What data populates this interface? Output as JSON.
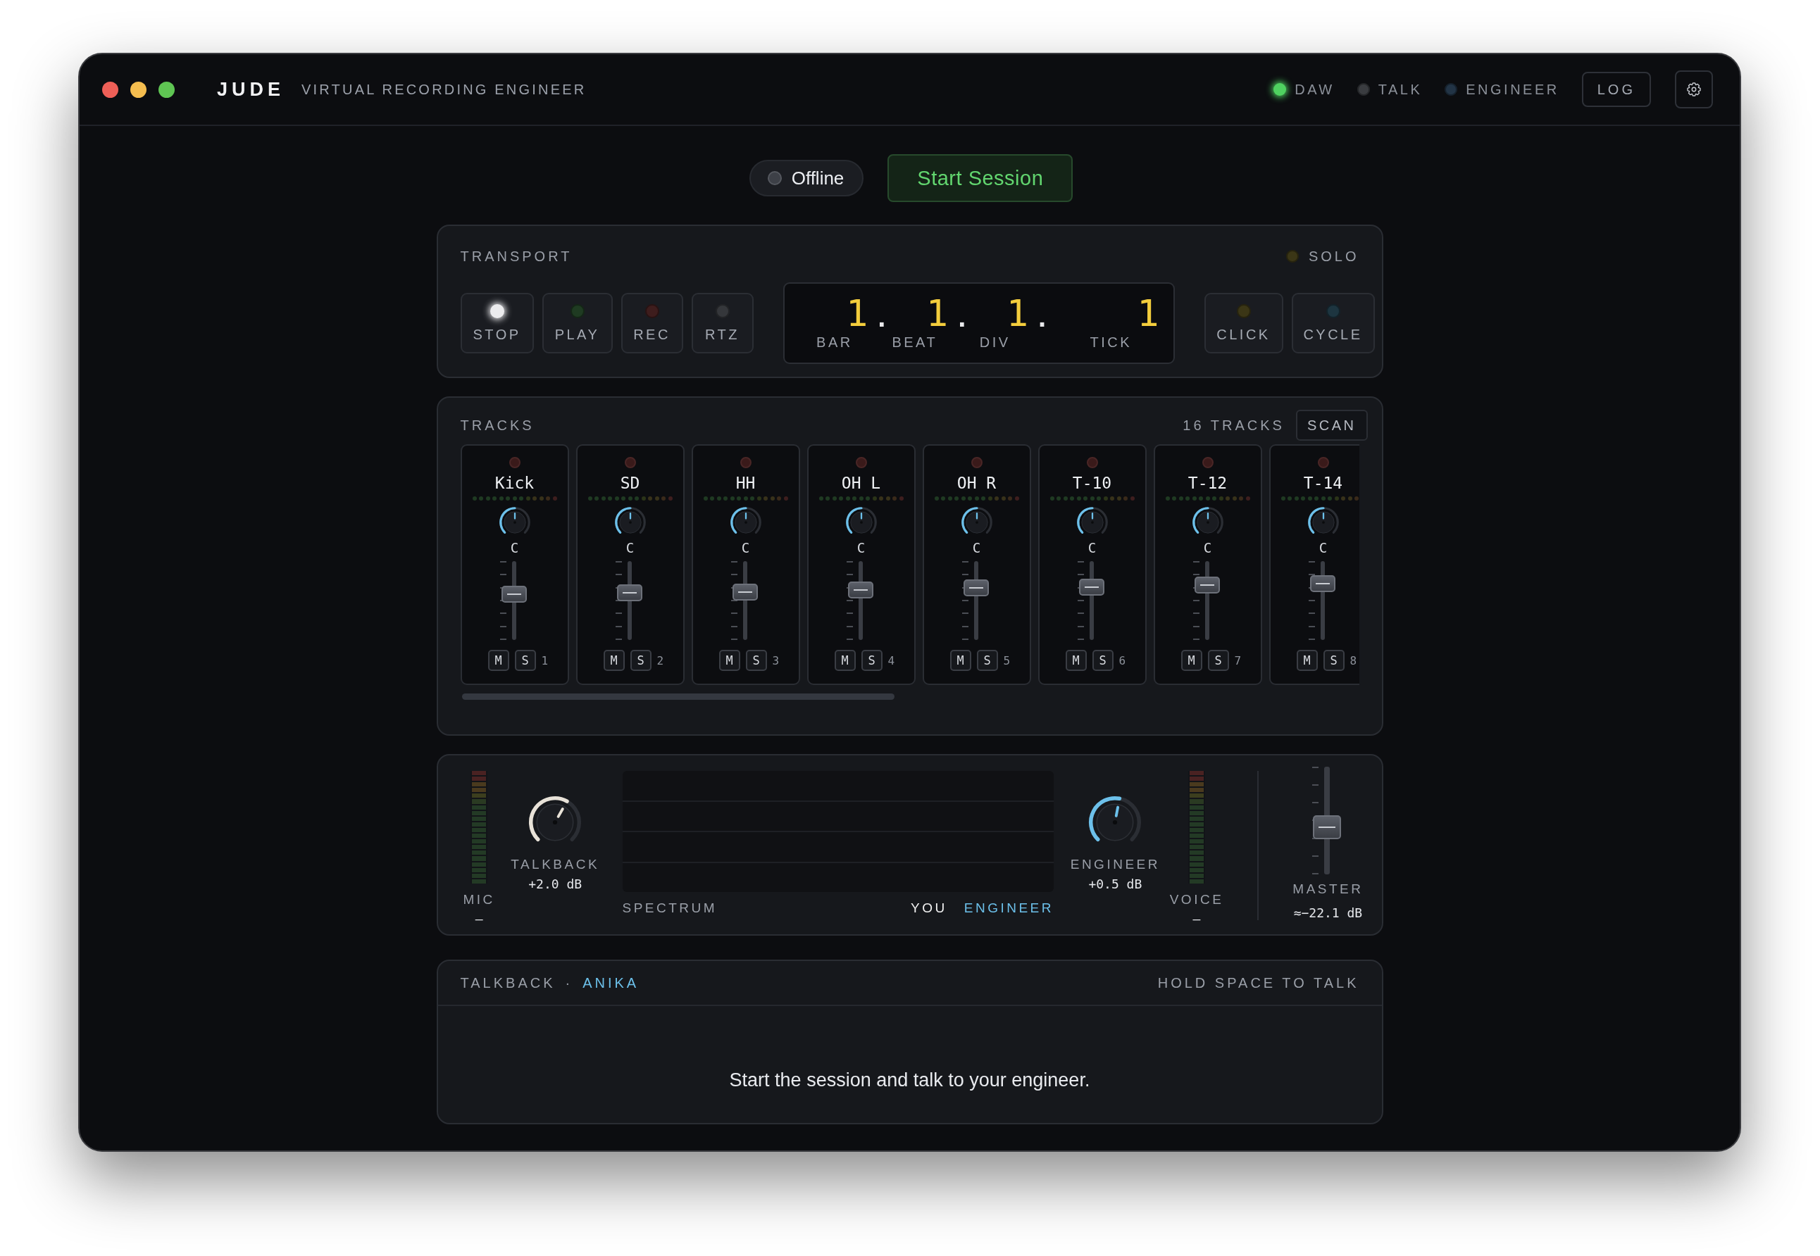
{
  "window": {
    "title": "JUDE",
    "subtitle": "VIRTUAL RECORDING ENGINEER"
  },
  "indicators": [
    {
      "label": "DAW",
      "on": true,
      "color": "#4fd160"
    },
    {
      "label": "TALK",
      "on": false,
      "color": "#3a3c40"
    },
    {
      "label": "ENGINEER",
      "on": false,
      "color": "#223446"
    }
  ],
  "log_button": "LOG",
  "session": {
    "status": "Offline",
    "online": false,
    "button": "Start Session"
  },
  "transport": {
    "title": "TRANSPORT",
    "solo": {
      "label": "SOLO",
      "on": false,
      "color": "#3b3616"
    },
    "buttons": [
      {
        "label": "STOP",
        "on": true,
        "color": "#ececee"
      },
      {
        "label": "PLAY",
        "on": false,
        "color": "#1f3b22"
      },
      {
        "label": "REC",
        "on": false,
        "color": "#3e1d1d"
      },
      {
        "label": "RTZ",
        "on": false,
        "color": "#35373b"
      }
    ],
    "counter": [
      {
        "value": "1",
        "label": "BAR",
        "separator": "."
      },
      {
        "value": "1",
        "label": "BEAT",
        "separator": "."
      },
      {
        "value": "1",
        "label": "DIV",
        "separator": "."
      },
      {
        "value": "1",
        "label": "TICK"
      }
    ],
    "toggles": [
      {
        "label": "CLICK",
        "on": false,
        "color": "#3b3616"
      },
      {
        "label": "CYCLE",
        "on": false,
        "color": "#1d3540"
      }
    ]
  },
  "tracks": {
    "title": "TRACKS",
    "count": "16 TRACKS",
    "scan_button": "SCAN",
    "strips": [
      {
        "name": "Kick",
        "armed": false,
        "pan": {
          "reading": "C",
          "level": 0.5
        },
        "fader": {
          "level": 0.6
        },
        "mute": "M",
        "solo": "S",
        "muted": false,
        "soloed": false,
        "number": "1"
      },
      {
        "name": "SD",
        "armed": false,
        "pan": {
          "reading": "C",
          "level": 0.5
        },
        "fader": {
          "level": 0.62
        },
        "mute": "M",
        "solo": "S",
        "muted": false,
        "soloed": false,
        "number": "2"
      },
      {
        "name": "HH",
        "armed": false,
        "pan": {
          "reading": "C",
          "level": 0.5
        },
        "fader": {
          "level": 0.64
        },
        "mute": "M",
        "solo": "S",
        "muted": false,
        "soloed": false,
        "number": "3"
      },
      {
        "name": "OH L",
        "armed": false,
        "pan": {
          "reading": "C",
          "level": 0.5
        },
        "fader": {
          "level": 0.67
        },
        "mute": "M",
        "solo": "S",
        "muted": false,
        "soloed": false,
        "number": "4"
      },
      {
        "name": "OH R",
        "armed": false,
        "pan": {
          "reading": "C",
          "level": 0.5
        },
        "fader": {
          "level": 0.7
        },
        "mute": "M",
        "solo": "S",
        "muted": false,
        "soloed": false,
        "number": "5"
      },
      {
        "name": "T-10",
        "armed": false,
        "pan": {
          "reading": "C",
          "level": 0.5
        },
        "fader": {
          "level": 0.72
        },
        "mute": "M",
        "solo": "S",
        "muted": false,
        "soloed": false,
        "number": "6"
      },
      {
        "name": "T-12",
        "armed": false,
        "pan": {
          "reading": "C",
          "level": 0.5
        },
        "fader": {
          "level": 0.75
        },
        "mute": "M",
        "solo": "S",
        "muted": false,
        "soloed": false,
        "number": "7"
      },
      {
        "name": "T-14",
        "armed": false,
        "pan": {
          "reading": "C",
          "level": 0.5
        },
        "fader": {
          "level": 0.77
        },
        "mute": "M",
        "solo": "S",
        "muted": false,
        "soloed": false,
        "number": "8"
      }
    ]
  },
  "mixer": [
    {
      "kind": "meter",
      "label": "MIC",
      "reading": "–"
    },
    {
      "kind": "knob",
      "label": "TALKBACK",
      "reading": "+2.0 dB",
      "level": 0.61,
      "color": "#e8e2d8"
    },
    {
      "kind": "spectrum",
      "label": "SPECTRUM",
      "legend": [
        {
          "label": "YOU",
          "color": "#f2f2f2"
        },
        {
          "label": "ENGINEER",
          "color": "#6cc0ea"
        }
      ]
    },
    {
      "kind": "knob",
      "label": "ENGINEER",
      "reading": "+0.5 dB",
      "level": 0.54,
      "color": "#6cc0ea"
    },
    {
      "kind": "meter",
      "label": "VOICE",
      "reading": "–"
    },
    {
      "kind": "fader",
      "label": "MASTER",
      "reading": "≈−22.1 dB",
      "level": 0.42
    }
  ],
  "talkback": {
    "title": "TALKBACK",
    "separator": "·",
    "name": "ANIKA",
    "hint": "HOLD SPACE TO TALK",
    "message": "Start the session and talk to your engineer."
  }
}
